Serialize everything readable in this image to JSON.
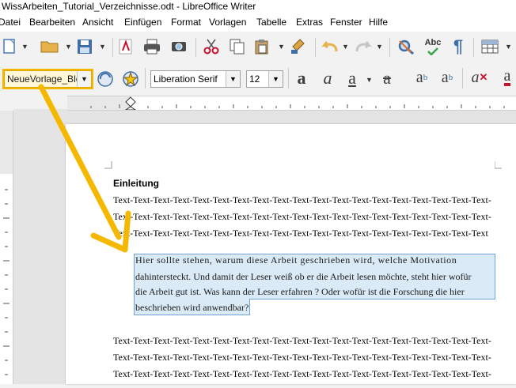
{
  "window": {
    "title": "WissArbeiten_Tutorial_Verzeichnisse.odt - LibreOffice Writer"
  },
  "menu": [
    "Datei",
    "Bearbeiten",
    "Ansicht",
    "Einfügen",
    "Format",
    "Vorlagen",
    "Tabelle",
    "Extras",
    "Fenster",
    "Hilfe"
  ],
  "format_bar": {
    "paragraph_style": "NeueVorlage_Blo",
    "font_name": "Liberation Serif",
    "font_size": "12"
  },
  "icons": {
    "new": "new-document-icon",
    "open": "open-folder-icon",
    "save": "save-icon",
    "pdf": "export-pdf-icon",
    "print": "print-icon",
    "preview": "print-preview-icon",
    "cut": "cut-icon",
    "copy": "copy-icon",
    "paste": "paste-icon",
    "clone": "clone-formatting-icon",
    "undo": "undo-icon",
    "redo": "redo-icon",
    "find": "find-replace-icon",
    "spell": "spellcheck-icon",
    "pilcrow": "formatting-marks-icon",
    "table": "insert-table-icon"
  },
  "document": {
    "heading": "Einleitung",
    "body_lines_top": [
      "Text-Text-Text-Text-Text-Text-Text-Text-Text-Text-Text-Text-Text-Text-Text-Text-Text-Text-Text-",
      "Text-Text-Text-Text-Text-Text-Text-Text-Text-Text-Text-Text-Text-Text-Text-Text-Text-Text-Text-",
      "Text-Text-Text-Text-Text-Text-Text-Text-Text-Text-Text-Text-Text-Text-Text-Text-Text-Text-Text"
    ],
    "selected_lines": [
      "Hier sollte stehen, warum diese Arbeit geschrieben wird, welche Motivation",
      "dahintersteckt. Und damit der Leser weiß ob er die Arbeit lesen möchte, steht hier wofür",
      "die Arbeit gut ist. Was kann der Leser erfahren ? Oder wofür ist die Forschung die hier",
      "beschrieben wird anwendbar?"
    ],
    "body_lines_bottom": [
      "Text-Text-Text-Text-Text-Text-Text-Text-Text-Text-Text-Text-Text-Text-Text-Text-Text-Text-Text-",
      "Text-Text-Text-Text-Text-Text-Text-Text-Text-Text-Text-Text-Text-Text-Text-Text-Text-Text-Text-",
      "Text-Text-Text-Text-Text-Text-Text-Text-Text-Text-Text-Text-Text-Text-Text-Text-Text-Text-Text-"
    ]
  },
  "colors": {
    "annotation_arrow": "#f5b800",
    "selection": "#dbeaf7"
  }
}
